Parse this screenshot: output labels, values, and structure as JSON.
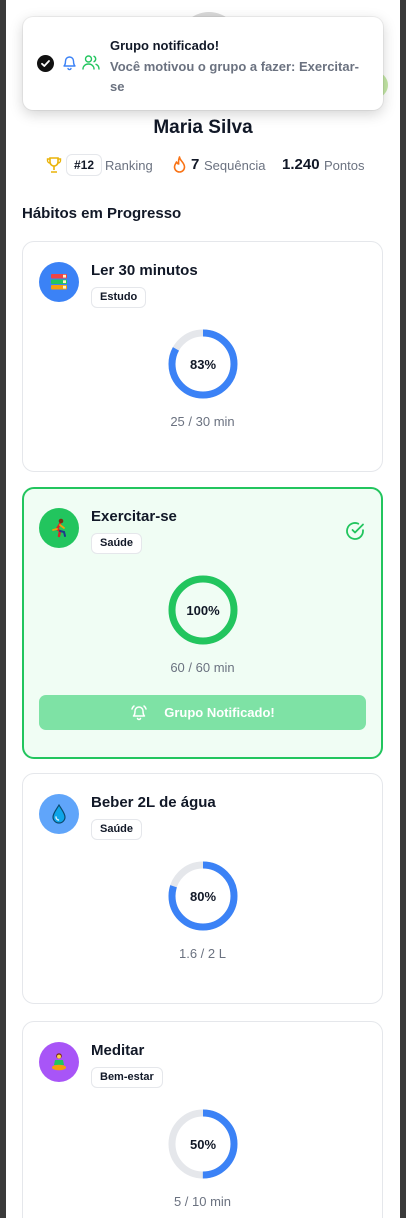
{
  "toast": {
    "title": "Grupo notificado!",
    "message": "Você motivou o grupo a fazer: Exercitar-se"
  },
  "profile": {
    "name": "Maria Silva",
    "rank": "#12",
    "rank_label": "Ranking",
    "streak": "7",
    "streak_label": "Sequência",
    "points": "1.240",
    "points_label": "Pontos"
  },
  "section_title": "Hábitos em Progresso",
  "habits": [
    {
      "title": "Ler 30 minutos",
      "tag": "Estudo",
      "percent_label": "83%",
      "percent": 83,
      "progress": "25 / 30 min",
      "icon": "books-icon",
      "icon_bg": "#3b82f6",
      "ring_color": "#3b82f6",
      "completed": false
    },
    {
      "title": "Exercitar-se",
      "tag": "Saúde",
      "percent_label": "100%",
      "percent": 100,
      "progress": "60 / 60 min",
      "icon": "running-person-icon",
      "icon_bg": "#22c55e",
      "ring_color": "#22c55e",
      "completed": true,
      "button_label": "Grupo Notificado!"
    },
    {
      "title": "Beber 2L de água",
      "tag": "Saúde",
      "percent_label": "80%",
      "percent": 80,
      "progress": "1.6 / 2 L",
      "icon": "water-drop-icon",
      "icon_bg": "#60a5fa",
      "ring_color": "#3b82f6",
      "completed": false
    },
    {
      "title": "Meditar",
      "tag": "Bem-estar",
      "percent_label": "50%",
      "percent": 50,
      "progress": "5 / 10 min",
      "icon": "meditation-icon",
      "icon_bg": "#a855f7",
      "ring_color": "#3b82f6",
      "completed": false
    }
  ],
  "colors": {
    "accent_green": "#22c55e",
    "accent_blue": "#3b82f6",
    "ring_track": "#e5e7eb"
  }
}
